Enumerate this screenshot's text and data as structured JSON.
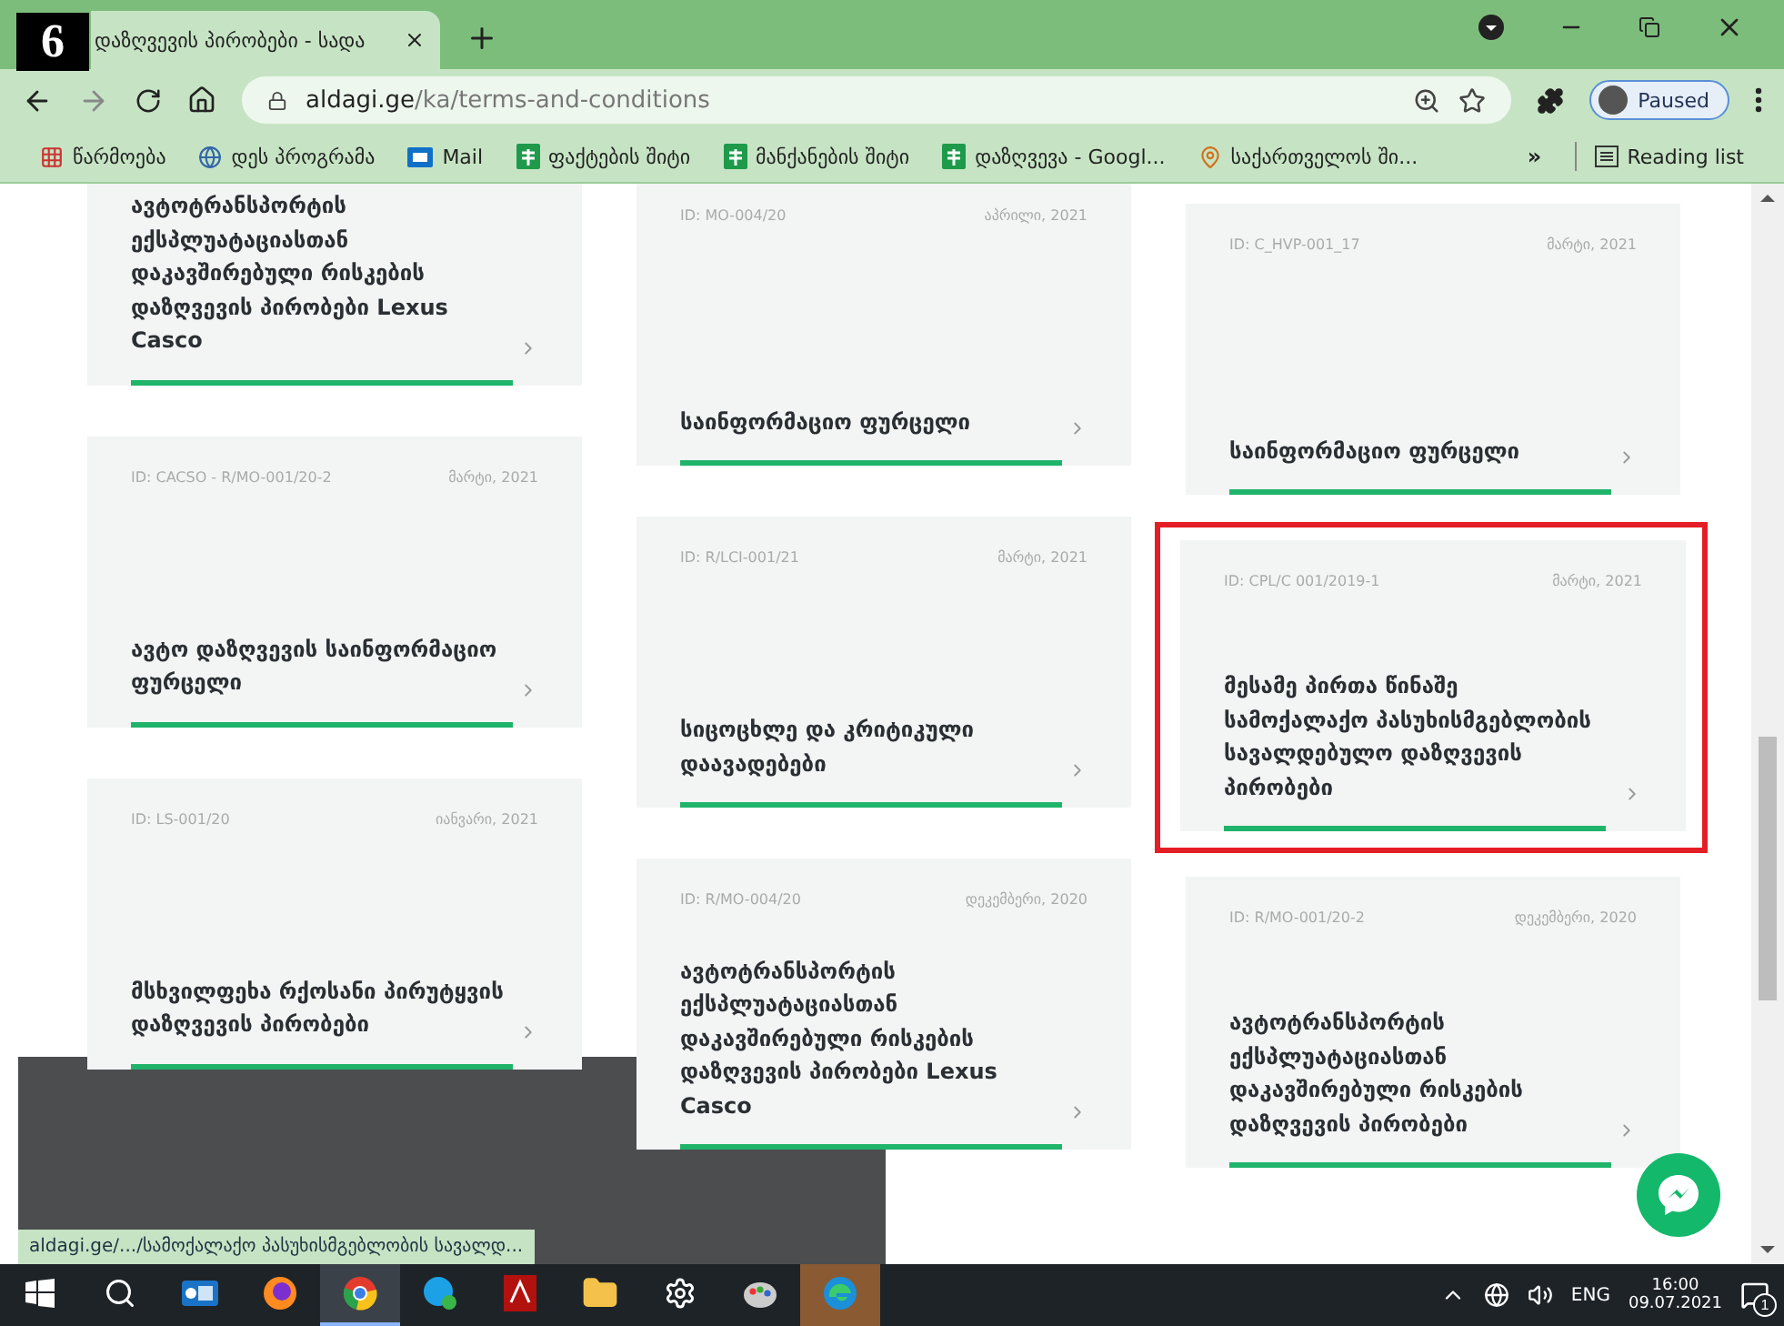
{
  "figure_label": "6",
  "browser": {
    "tab_title": "დაზღვევის პირობები - სადა",
    "url_host": "aldagi.ge",
    "url_path": "/ka/terms-and-conditions",
    "profile": "Paused",
    "bookmarks": [
      {
        "kind": "apps",
        "label": "წარმოება"
      },
      {
        "kind": "globe",
        "label": "დეს პროგრამა"
      },
      {
        "kind": "mail",
        "label": "Mail"
      },
      {
        "kind": "sheet",
        "label": "ფაქტების შიტი"
      },
      {
        "kind": "sheet",
        "label": "მანქანების შიტი"
      },
      {
        "kind": "sheet",
        "label": "დაზღვევა - Googl..."
      },
      {
        "kind": "pin",
        "label": "საქართველოს ში..."
      }
    ],
    "more_bookmarks": "»",
    "reading_list": "Reading list"
  },
  "columns": [
    {
      "cards": [
        {
          "title": "ავტოტრანსპორტის ექსპლუატაციასთან დაკავშირებული რისკების დაზღვევის პირობები Lexus Casco",
          "highlighted": false
        },
        {
          "id": "ID: CACSO - R/MO-001/20-2",
          "date": "მარტი, 2021",
          "title": "ავტო დაზღვევის საინფორმაციო ფურცელი",
          "highlighted": false
        },
        {
          "id": "ID: LS-001/20",
          "date": "იანვარი, 2021",
          "title": "მსხვილფეხა რქოსანი პირუტყვის დაზღვევის პირობები",
          "highlighted": false
        }
      ]
    },
    {
      "cards": [
        {
          "id": "ID: MO-004/20",
          "date": "აპრილი, 2021",
          "title": "საინფორმაციო ფურცელი",
          "highlighted": false
        },
        {
          "id": "ID: R/LCI-001/21",
          "date": "მარტი, 2021",
          "title": "სიცოცხლე და კრიტიკული დაავადებები",
          "highlighted": false
        },
        {
          "id": "ID: R/MO-004/20",
          "date": "დეკემბერი, 2020",
          "title": "ავტოტრანსპორტის ექსპლუატაციასთან დაკავშირებული რისკების დაზღვევის პირობები Lexus Casco",
          "highlighted": false
        }
      ]
    },
    {
      "cards": [
        {
          "id": "ID: C_HVP-001_17",
          "date": "მარტი, 2021",
          "title": "საინფორმაციო ფურცელი",
          "highlighted": false
        },
        {
          "id": "ID: CPL/C 001/2019-1",
          "date": "მარტი, 2021",
          "title": "მესამე პირთა წინაშე სამოქალაქო პასუხისმგებლობის სავალდებულო დაზღვევის პირობები",
          "highlighted": true
        },
        {
          "id": "ID: R/MO-001/20-2",
          "date": "დეკემბერი, 2020",
          "title": "ავტოტრანსპორტის ექსპლუატაციასთან დაკავშირებული რისკების დაზღვევის პირობები",
          "highlighted": false
        }
      ]
    }
  ],
  "status_link": "aldagi.ge/.../სამოქალაქო პასუხისმგებლობის სავალდ...",
  "taskbar": {
    "apps": [
      {
        "kind": "search",
        "active": false,
        "attention": false
      },
      {
        "kind": "outlook",
        "active": false,
        "attention": false
      },
      {
        "kind": "firefox",
        "active": false,
        "attention": false
      },
      {
        "kind": "chrome",
        "active": true,
        "attention": false
      },
      {
        "kind": "skype",
        "active": false,
        "attention": false
      },
      {
        "kind": "pdf",
        "active": false,
        "attention": false
      },
      {
        "kind": "folder",
        "active": false,
        "attention": false
      },
      {
        "kind": "settings",
        "active": false,
        "attention": false
      },
      {
        "kind": "paint",
        "active": false,
        "attention": false
      },
      {
        "kind": "edge",
        "active": false,
        "attention": true
      }
    ],
    "language": "ENG",
    "time": "16:00",
    "date": "09.07.2021",
    "notifications": "1"
  }
}
